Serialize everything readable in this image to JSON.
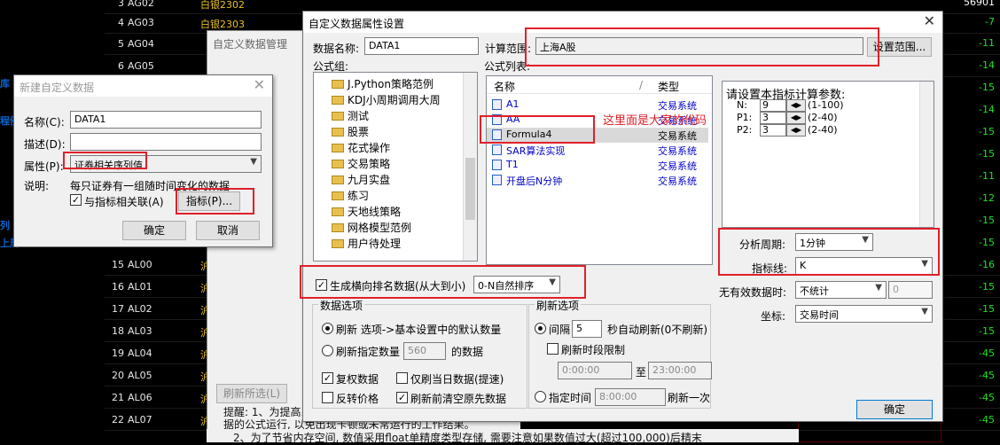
{
  "bg": {
    "left_labels": [
      "库",
      "程例",
      "列",
      "上周"
    ],
    "rows": [
      {
        "num": "3",
        "code": "AG02",
        "name": "白银2302"
      },
      {
        "num": "4",
        "code": "AG03",
        "name": "白银2303"
      },
      {
        "num": "5",
        "code": "AG04",
        "name": ""
      },
      {
        "num": "6",
        "code": "AG05",
        "name": ""
      },
      {
        "num": "15",
        "code": "AL00",
        "name": "沪"
      },
      {
        "num": "16",
        "code": "AL01",
        "name": "沪"
      },
      {
        "num": "17",
        "code": "AL02",
        "name": "沪"
      },
      {
        "num": "18",
        "code": "AL03",
        "name": "沪"
      },
      {
        "num": "19",
        "code": "AL04",
        "name": "沪"
      },
      {
        "num": "20",
        "code": "AL05",
        "name": "沪"
      },
      {
        "num": "21",
        "code": "AL06",
        "name": "沪"
      },
      {
        "num": "22",
        "code": "AL07",
        "name": "沪"
      }
    ],
    "right_values": [
      "-7",
      "-11",
      "-14",
      "-15",
      "-14",
      "-15",
      "-15",
      "-11",
      "-12",
      "-15",
      "-15",
      "-16",
      "-15",
      "-15",
      "-15",
      "-45",
      "-45",
      "-45",
      "-45",
      "-46"
    ],
    "right_top": "56901"
  },
  "mid_window": {
    "title": "自定义数据管理"
  },
  "new_dialog": {
    "title": "新建自定义数据",
    "name_label": "名称(C):",
    "name_value": "DATA1",
    "desc_label": "描述(D):",
    "desc_value": "",
    "attr_label": "属性(P):",
    "attr_value": "证券相关序列值",
    "note_label": "说明:",
    "note_text": "每只证券有一组随时间变化的数据",
    "link_label": "与指标相关联(A)",
    "indicator_button": "指标(P)...",
    "ok": "确定",
    "cancel": "取消"
  },
  "attr_dialog": {
    "title": "自定义数据属性设置",
    "data_name_label": "数据名称:",
    "data_name_value": "DATA1",
    "calc_range_label": "计算范围:",
    "calc_range_value": "上海A股",
    "set_range_button": "设置范围...",
    "formula_group_label": "公式组:",
    "formula_list_label": "公式列表:",
    "tree_items": [
      "J.Python策略范例",
      "KDJ小周期调用大周",
      "测试",
      "股票",
      "花式操作",
      "交易策略",
      "九月实盘",
      "练习",
      "天地线策略",
      "网格模型范例",
      "用户待处理"
    ],
    "list_header_name": "名称",
    "list_header_sort": "/",
    "list_header_type": "类型",
    "formulas": [
      {
        "name": "A1",
        "type": "交易系统"
      },
      {
        "name": "AA",
        "type": "交易系统"
      },
      {
        "name": "Formula4",
        "type": "交易系统"
      },
      {
        "name": "SAR算法实现",
        "type": "交易系统"
      },
      {
        "name": "T1",
        "type": "交易系统"
      },
      {
        "name": "开盘后N分钟",
        "type": "交易系统"
      }
    ],
    "annotation": "这里面是大家的代码",
    "param_title": "请设置本指标计算参数:",
    "params": [
      {
        "name": "N:",
        "value": "9",
        "range": "(1-100)"
      },
      {
        "name": "P1:",
        "value": "3",
        "range": "(2-40)"
      },
      {
        "name": "P2:",
        "value": "3",
        "range": "(2-40)"
      }
    ],
    "period_label": "分析周期:",
    "period_value": "1分钟",
    "indicator_line_label": "指标线:",
    "indicator_line_value": "K",
    "no_data_label": "无有效数据时:",
    "no_data_value": "不统计",
    "no_data_num": "0",
    "axis_label": "坐标:",
    "axis_value": "交易时间",
    "gen_rank_label": "生成横向排名数据(从大到小)",
    "sort_value": "0-N自然排序",
    "data_options_title": "数据选项",
    "refresh_default": "刷新  选项->基本设置中的默认数量",
    "refresh_count_label": "刷新指定数量",
    "refresh_count_value": "560",
    "refresh_count_suffix": "的数据",
    "restore_rights": "复权数据",
    "only_today": "仅刷当日数据(提速)",
    "reverse_price": "反转价格",
    "clear_before": "刷新前清空原先数据",
    "refresh_options_title": "刷新选项",
    "interval_label": "间隔",
    "interval_value": "5",
    "interval_suffix": "秒自动刷新(0不刷新)",
    "period_limit": "刷新时段限制",
    "time_from": "0:00:00",
    "time_to_label": "至",
    "time_to": "23:00:00",
    "fixed_time_label": "指定时间",
    "fixed_time_value": "8:00:00",
    "fixed_time_suffix": "刷新一次",
    "ok": "确定"
  },
  "bottom": {
    "refresh_selected": "刷新所选(L)",
    "tip1": "提醒: 1、为提高系",
    "tip1b": "据的公式运行, 以免出现卡顿或未常运行的工作结果。",
    "tip2": "2、为了节省内存空间, 数值采用float单精度类型存储, 需要注意如果数值过大(超过100,000)后精末"
  }
}
